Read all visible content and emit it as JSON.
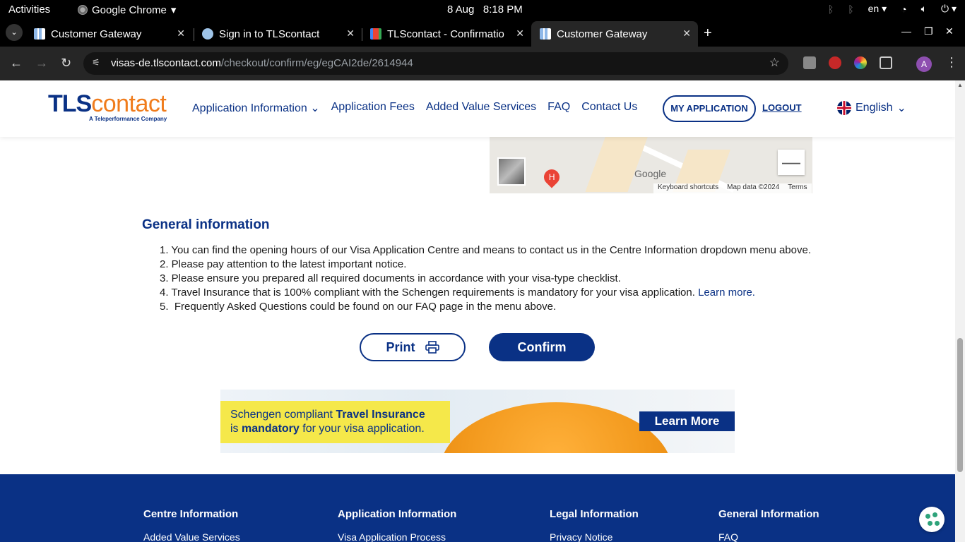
{
  "system_bar": {
    "activities": "Activities",
    "app_name": "Google Chrome",
    "date": "8 Aug",
    "time": "8:18 PM",
    "language": "en"
  },
  "tabs": [
    {
      "title": "Customer Gateway",
      "active": false
    },
    {
      "title": "Sign in to TLScontact",
      "active": false
    },
    {
      "title": "TLScontact - Confirmation",
      "active": false
    },
    {
      "title": "Customer Gateway",
      "active": true
    }
  ],
  "omnibox": {
    "host": "visas-de.tlscontact.com",
    "path": "/checkout/confirm/eg/egCAI2de/2614944"
  },
  "profile": {
    "initial": "A"
  },
  "site": {
    "logo_tl": "TLS",
    "logo_contact": "contact",
    "logo_sub": "A Teleperformance Company",
    "nav": [
      "Application Information",
      "Application Fees",
      "Added Value Services",
      "FAQ",
      "Contact Us"
    ],
    "my_application": "MY APPLICATION",
    "logout": "LOGOUT",
    "language": "English"
  },
  "map": {
    "google": "Google",
    "shortcuts": "Keyboard shortcuts",
    "map_data": "Map data ©2024",
    "terms": "Terms",
    "zoom_out": "—",
    "pin": "H"
  },
  "general_info": {
    "title": "General information",
    "items": [
      "1. You can find the opening hours of our Visa Application Centre and means to contact us in the Centre Information dropdown menu above.",
      "2. Please pay attention to the latest important notice.",
      "3. Please ensure you prepared all required documents in accordance with your visa-type checklist.",
      "4. Travel Insurance that is 100% compliant with the Schengen requirements is mandatory for your visa application.",
      "5.  Frequently Asked Questions could be found on our FAQ page in the menu above."
    ],
    "learn_more": "Learn more."
  },
  "buttons": {
    "print": "Print",
    "confirm": "Confirm"
  },
  "banner": {
    "line1_a": "Schengen compliant ",
    "line1_b": "Travel Insurance",
    "line2_a": "is ",
    "line2_b": "mandatory",
    "line2_c": " for your visa application.",
    "cta": "Learn More"
  },
  "footer": {
    "columns": [
      {
        "heading": "Centre Information",
        "first_item": "Added Value Services"
      },
      {
        "heading": "Application Information",
        "first_item": "Visa Application Process"
      },
      {
        "heading": "Legal Information",
        "first_item": "Privacy Notice"
      },
      {
        "heading": "General Information",
        "first_item": "FAQ"
      }
    ]
  },
  "colors": {
    "brand_blue": "#0a3185",
    "brand_orange": "#f07c1c"
  }
}
